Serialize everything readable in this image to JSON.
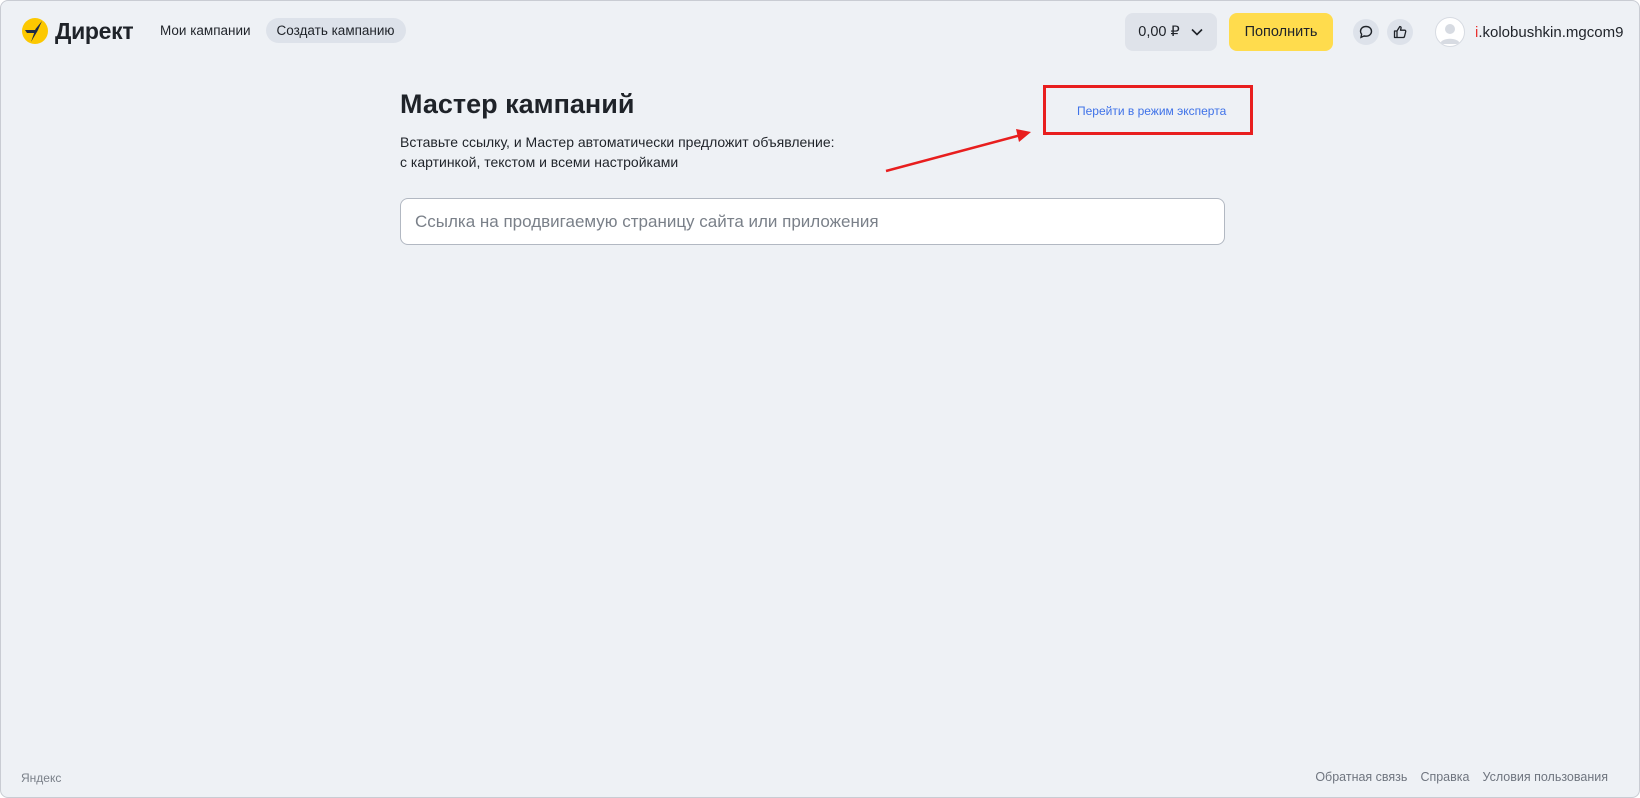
{
  "app": {
    "logo_text": "Директ",
    "logo_icon": "yandex-direct-logo"
  },
  "nav": {
    "items": [
      {
        "label": "Мои кампании",
        "active": false
      },
      {
        "label": "Создать кампанию",
        "active": true
      }
    ]
  },
  "header": {
    "balance": "0,00 ₽",
    "balance_icon": "chevron-down-icon",
    "topup_label": "Пополнить",
    "chat_icon": "chat-bubble-icon",
    "feedback_icon": "thumbs-up-icon",
    "user": {
      "login_first": "i",
      "login_rest": ".kolobushkin.mgcom9",
      "avatar_icon": "user-avatar-icon"
    }
  },
  "main": {
    "title": "Мастер кампаний",
    "subtitle_line1": "Вставьте ссылку, и Мастер автоматически предложит объявление:",
    "subtitle_line2": "с картинкой, текстом и всеми настройками",
    "expert_link": "Перейти в режим эксперта",
    "url_input": {
      "value": "",
      "placeholder": "Ссылка на продвигаемую страницу сайта или приложения"
    }
  },
  "annotation": {
    "box_color": "#e81e1e",
    "arrow_color": "#e81e1e"
  },
  "footer": {
    "brand": "Яндекс",
    "links": [
      "Обратная связь",
      "Справка",
      "Условия пользования"
    ]
  },
  "colors": {
    "accent_yellow": "#ffdc4d",
    "link_blue": "#3f72e8",
    "background": "#eef1f5"
  }
}
